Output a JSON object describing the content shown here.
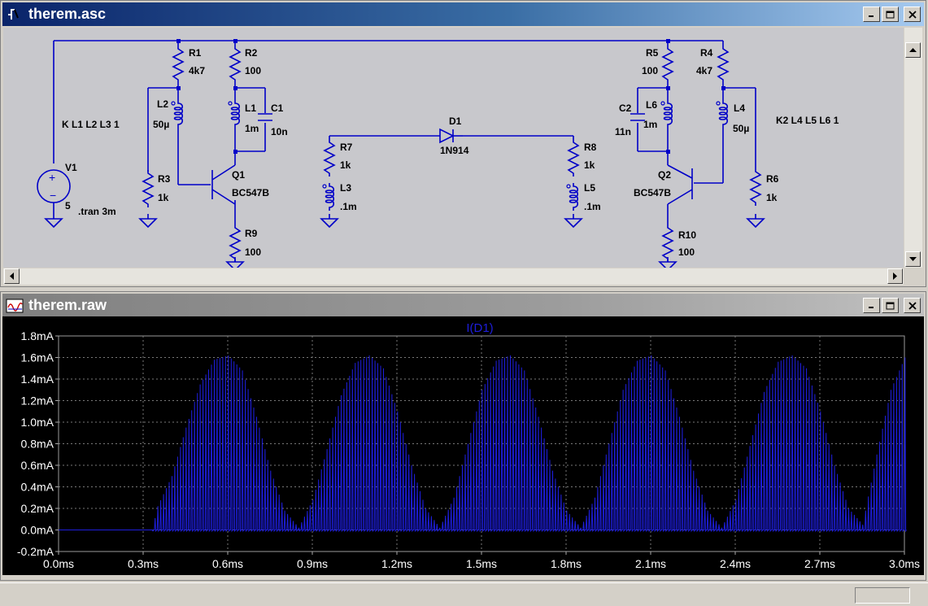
{
  "schematic_window": {
    "title": "therem.asc",
    "components": [
      {
        "ref": "R1",
        "value": "4k7"
      },
      {
        "ref": "R2",
        "value": "100"
      },
      {
        "ref": "L2",
        "value": "50µ"
      },
      {
        "ref": "L1",
        "value": "1m"
      },
      {
        "ref": "C1",
        "value": "10n"
      },
      {
        "ref": "R3",
        "value": "1k"
      },
      {
        "ref": "Q1",
        "value": "BC547B"
      },
      {
        "ref": "R9",
        "value": "100"
      },
      {
        "ref": "V1",
        "value": "5"
      },
      {
        "ref": "R7",
        "value": "1k"
      },
      {
        "ref": "L3",
        "value": ".1m"
      },
      {
        "ref": "D1",
        "value": "1N914"
      },
      {
        "ref": "R8",
        "value": "1k"
      },
      {
        "ref": "L5",
        "value": ".1m"
      },
      {
        "ref": "R5",
        "value": "100"
      },
      {
        "ref": "R4",
        "value": "4k7"
      },
      {
        "ref": "C2",
        "value": "11n"
      },
      {
        "ref": "L6",
        "value": "1m"
      },
      {
        "ref": "L4",
        "value": "50µ"
      },
      {
        "ref": "Q2",
        "value": "BC547B"
      },
      {
        "ref": "R10",
        "value": "100"
      },
      {
        "ref": "R6",
        "value": "1k"
      }
    ],
    "directives": [
      "K L1 L2 L3 1",
      ".tran 3m",
      "K2 L4 L5 L6 1"
    ]
  },
  "waveform_window": {
    "title": "therem.raw"
  },
  "colors": {
    "wire": "#0000c8",
    "trace": "#1e1edc",
    "plot_bg": "#000000",
    "grid": "#787878"
  },
  "chart_data": {
    "type": "line",
    "title": "I(D1)",
    "xlabel": "",
    "ylabel": "",
    "xlim": [
      0,
      3.0
    ],
    "ylim": [
      -0.2,
      1.8
    ],
    "x_unit": "ms",
    "y_unit": "mA",
    "x_ticks": [
      "0.0ms",
      "0.3ms",
      "0.6ms",
      "0.9ms",
      "1.2ms",
      "1.5ms",
      "1.8ms",
      "2.1ms",
      "2.4ms",
      "2.7ms",
      "3.0ms"
    ],
    "y_ticks": [
      "1.8mA",
      "1.6mA",
      "1.4mA",
      "1.2mA",
      "1.0mA",
      "0.8mA",
      "0.6mA",
      "0.4mA",
      "0.2mA",
      "0.0mA",
      "-0.2mA"
    ],
    "grid": true,
    "series": [
      {
        "name": "I(D1)",
        "description_type": "pulsed",
        "pulse_spacing_ms": 0.01,
        "x": [
          0.0,
          0.33,
          0.35,
          0.4,
          0.45,
          0.5,
          0.55,
          0.6,
          0.65,
          0.7,
          0.75,
          0.8,
          0.85,
          0.9,
          0.95,
          1.0,
          1.05,
          1.1,
          1.15,
          1.2,
          1.25,
          1.3,
          1.35,
          1.4,
          1.45,
          1.5,
          1.55,
          1.6,
          1.65,
          1.7,
          1.75,
          1.8,
          1.85,
          1.9,
          1.95,
          2.0,
          2.05,
          2.1,
          2.15,
          2.2,
          2.25,
          2.3,
          2.35,
          2.4,
          2.45,
          2.5,
          2.55,
          2.6,
          2.65,
          2.7,
          2.75,
          2.8,
          2.85,
          2.9,
          2.95,
          3.0
        ],
        "y": [
          0.0,
          0.0,
          0.22,
          0.5,
          0.95,
          1.35,
          1.58,
          1.62,
          1.48,
          1.05,
          0.55,
          0.18,
          0.02,
          0.28,
          0.75,
          1.25,
          1.55,
          1.62,
          1.5,
          1.1,
          0.6,
          0.2,
          0.02,
          0.3,
          0.8,
          1.3,
          1.57,
          1.62,
          1.48,
          1.05,
          0.55,
          0.18,
          0.02,
          0.3,
          0.8,
          1.3,
          1.57,
          1.62,
          1.48,
          1.05,
          0.55,
          0.18,
          0.02,
          0.28,
          0.78,
          1.28,
          1.56,
          1.62,
          1.5,
          1.1,
          0.6,
          0.2,
          0.05,
          0.7,
          1.3,
          1.6
        ]
      }
    ]
  }
}
